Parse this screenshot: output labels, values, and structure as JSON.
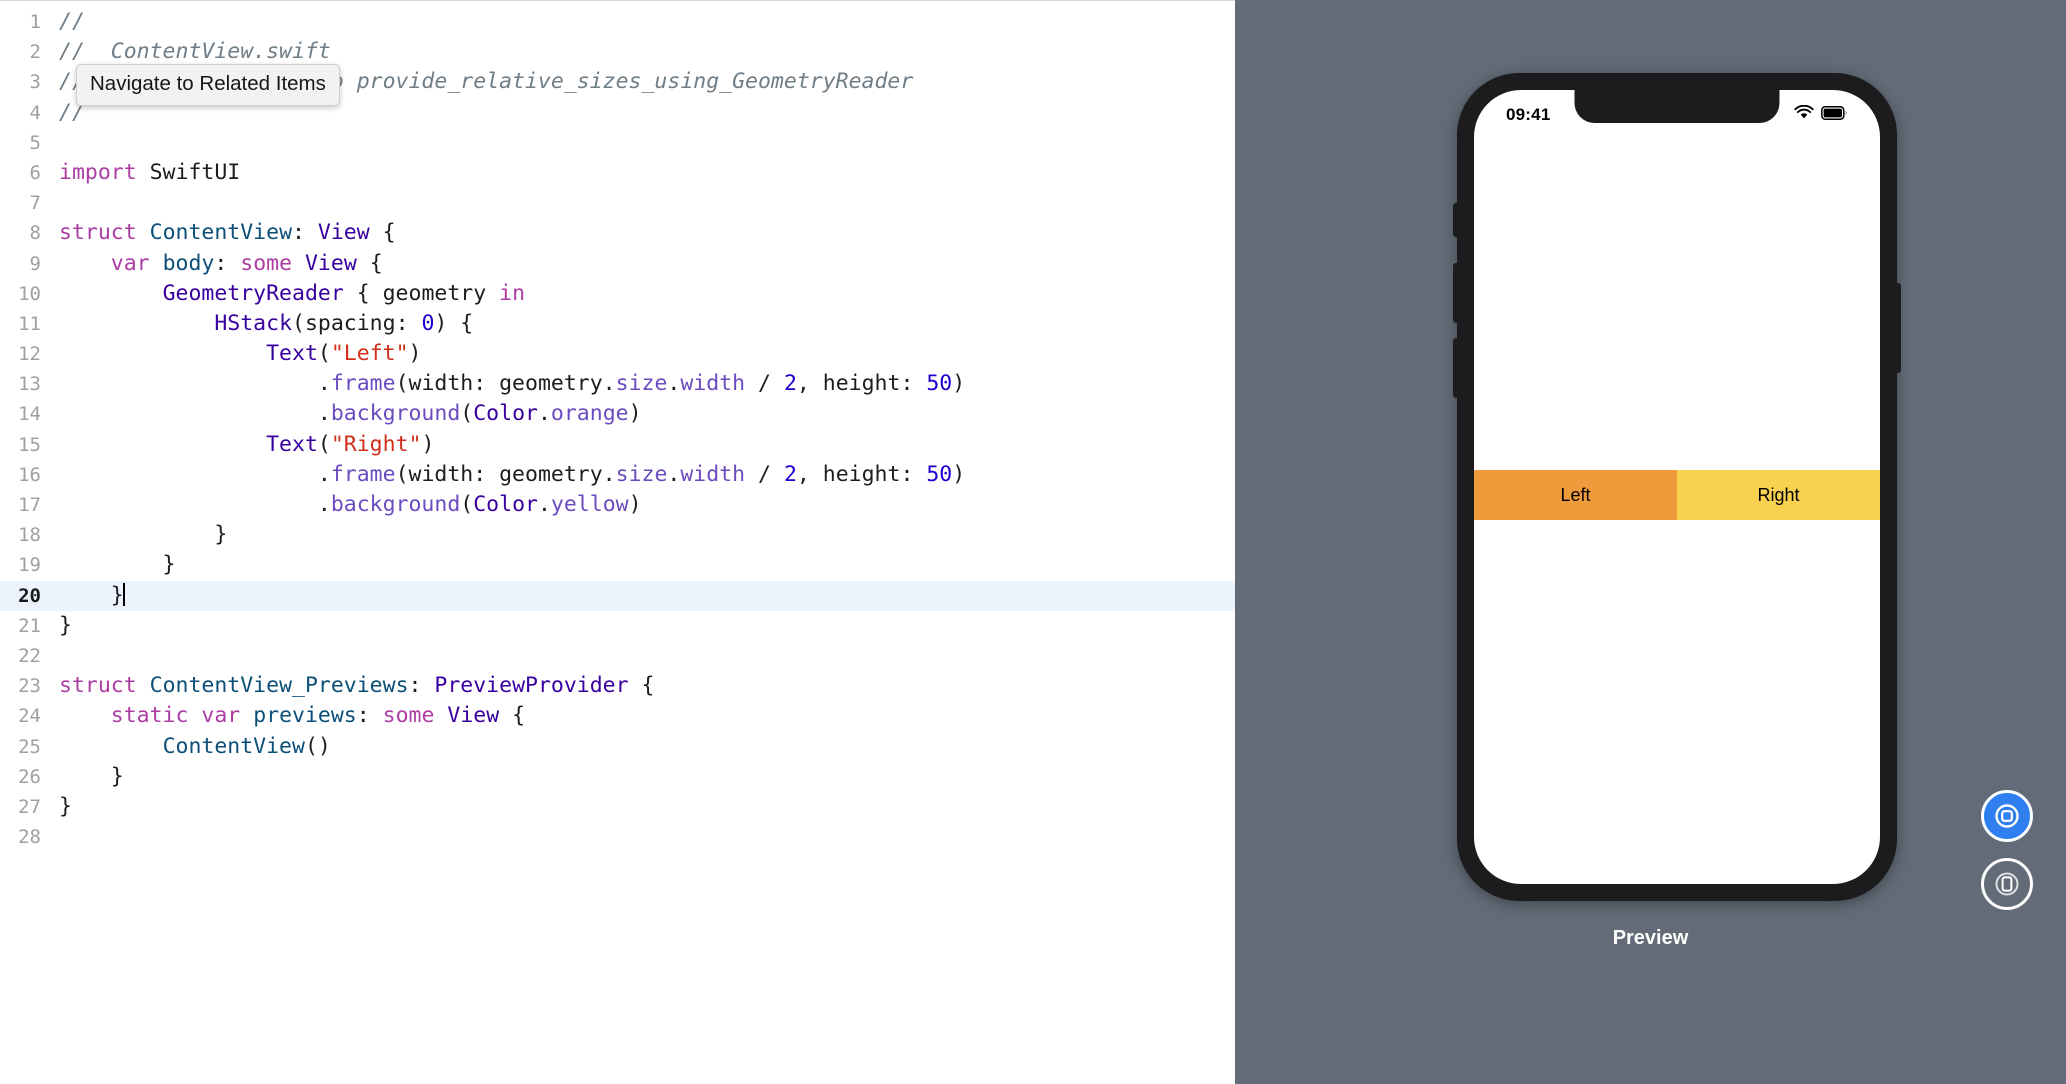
{
  "editor": {
    "tooltip": "Navigate to Related Items",
    "current_line": 20,
    "lines": [
      {
        "n": "1",
        "tokens": [
          {
            "t": "cmt",
            "s": "//"
          }
        ]
      },
      {
        "n": "2",
        "tokens": [
          {
            "t": "cmt",
            "s": "//  ContentView.swift"
          }
        ]
      },
      {
        "n": "3",
        "tokens": [
          {
            "t": "cmt",
            "s": "//  Project2-12 How to provide_relative_sizes_using_GeometryReader"
          }
        ]
      },
      {
        "n": "4",
        "tokens": [
          {
            "t": "cmt",
            "s": "//"
          }
        ]
      },
      {
        "n": "5",
        "tokens": []
      },
      {
        "n": "6",
        "tokens": [
          {
            "t": "kw",
            "s": "import"
          },
          {
            "t": "plain",
            "s": " SwiftUI"
          }
        ]
      },
      {
        "n": "7",
        "tokens": []
      },
      {
        "n": "8",
        "tokens": [
          {
            "t": "kw",
            "s": "struct"
          },
          {
            "t": "plain",
            "s": " "
          },
          {
            "t": "typ",
            "s": "ContentView"
          },
          {
            "t": "plain",
            "s": ": "
          },
          {
            "t": "typ2",
            "s": "View"
          },
          {
            "t": "plain",
            "s": " {"
          }
        ]
      },
      {
        "n": "9",
        "tokens": [
          {
            "t": "plain",
            "s": "    "
          },
          {
            "t": "kw",
            "s": "var"
          },
          {
            "t": "plain",
            "s": " "
          },
          {
            "t": "typ",
            "s": "body"
          },
          {
            "t": "plain",
            "s": ": "
          },
          {
            "t": "kw",
            "s": "some"
          },
          {
            "t": "plain",
            "s": " "
          },
          {
            "t": "typ2",
            "s": "View"
          },
          {
            "t": "plain",
            "s": " {"
          }
        ]
      },
      {
        "n": "10",
        "tokens": [
          {
            "t": "plain",
            "s": "        "
          },
          {
            "t": "typ2",
            "s": "GeometryReader"
          },
          {
            "t": "plain",
            "s": " { geometry "
          },
          {
            "t": "kw",
            "s": "in"
          }
        ]
      },
      {
        "n": "11",
        "tokens": [
          {
            "t": "plain",
            "s": "            "
          },
          {
            "t": "typ2",
            "s": "HStack"
          },
          {
            "t": "plain",
            "s": "(spacing: "
          },
          {
            "t": "num",
            "s": "0"
          },
          {
            "t": "plain",
            "s": ") {"
          }
        ]
      },
      {
        "n": "12",
        "tokens": [
          {
            "t": "plain",
            "s": "                "
          },
          {
            "t": "typ2",
            "s": "Text"
          },
          {
            "t": "plain",
            "s": "("
          },
          {
            "t": "str",
            "s": "\"Left\""
          },
          {
            "t": "plain",
            "s": ")"
          }
        ]
      },
      {
        "n": "13",
        "tokens": [
          {
            "t": "plain",
            "s": "                    ."
          },
          {
            "t": "prop",
            "s": "frame"
          },
          {
            "t": "plain",
            "s": "(width: geometry."
          },
          {
            "t": "prop",
            "s": "size"
          },
          {
            "t": "plain",
            "s": "."
          },
          {
            "t": "prop",
            "s": "width"
          },
          {
            "t": "plain",
            "s": " / "
          },
          {
            "t": "num",
            "s": "2"
          },
          {
            "t": "plain",
            "s": ", height: "
          },
          {
            "t": "num",
            "s": "50"
          },
          {
            "t": "plain",
            "s": ")"
          }
        ]
      },
      {
        "n": "14",
        "tokens": [
          {
            "t": "plain",
            "s": "                    ."
          },
          {
            "t": "prop",
            "s": "background"
          },
          {
            "t": "plain",
            "s": "("
          },
          {
            "t": "typ2",
            "s": "Color"
          },
          {
            "t": "plain",
            "s": "."
          },
          {
            "t": "prop",
            "s": "orange"
          },
          {
            "t": "plain",
            "s": ")"
          }
        ]
      },
      {
        "n": "15",
        "tokens": [
          {
            "t": "plain",
            "s": "                "
          },
          {
            "t": "typ2",
            "s": "Text"
          },
          {
            "t": "plain",
            "s": "("
          },
          {
            "t": "str",
            "s": "\"Right\""
          },
          {
            "t": "plain",
            "s": ")"
          }
        ]
      },
      {
        "n": "16",
        "tokens": [
          {
            "t": "plain",
            "s": "                    ."
          },
          {
            "t": "prop",
            "s": "frame"
          },
          {
            "t": "plain",
            "s": "(width: geometry."
          },
          {
            "t": "prop",
            "s": "size"
          },
          {
            "t": "plain",
            "s": "."
          },
          {
            "t": "prop",
            "s": "width"
          },
          {
            "t": "plain",
            "s": " / "
          },
          {
            "t": "num",
            "s": "2"
          },
          {
            "t": "plain",
            "s": ", height: "
          },
          {
            "t": "num",
            "s": "50"
          },
          {
            "t": "plain",
            "s": ")"
          }
        ]
      },
      {
        "n": "17",
        "tokens": [
          {
            "t": "plain",
            "s": "                    ."
          },
          {
            "t": "prop",
            "s": "background"
          },
          {
            "t": "plain",
            "s": "("
          },
          {
            "t": "typ2",
            "s": "Color"
          },
          {
            "t": "plain",
            "s": "."
          },
          {
            "t": "prop",
            "s": "yellow"
          },
          {
            "t": "plain",
            "s": ")"
          }
        ]
      },
      {
        "n": "18",
        "tokens": [
          {
            "t": "plain",
            "s": "            }"
          }
        ]
      },
      {
        "n": "19",
        "tokens": [
          {
            "t": "plain",
            "s": "        }"
          }
        ]
      },
      {
        "n": "20",
        "tokens": [
          {
            "t": "plain",
            "s": "    }"
          }
        ],
        "caret": true
      },
      {
        "n": "21",
        "tokens": [
          {
            "t": "plain",
            "s": "}"
          }
        ]
      },
      {
        "n": "22",
        "tokens": []
      },
      {
        "n": "23",
        "tokens": [
          {
            "t": "kw",
            "s": "struct"
          },
          {
            "t": "plain",
            "s": " "
          },
          {
            "t": "typ",
            "s": "ContentView_Previews"
          },
          {
            "t": "plain",
            "s": ": "
          },
          {
            "t": "typ2",
            "s": "PreviewProvider"
          },
          {
            "t": "plain",
            "s": " {"
          }
        ]
      },
      {
        "n": "24",
        "tokens": [
          {
            "t": "plain",
            "s": "    "
          },
          {
            "t": "kw",
            "s": "static"
          },
          {
            "t": "plain",
            "s": " "
          },
          {
            "t": "kw",
            "s": "var"
          },
          {
            "t": "plain",
            "s": " "
          },
          {
            "t": "typ",
            "s": "previews"
          },
          {
            "t": "plain",
            "s": ": "
          },
          {
            "t": "kw",
            "s": "some"
          },
          {
            "t": "plain",
            "s": " "
          },
          {
            "t": "typ2",
            "s": "View"
          },
          {
            "t": "plain",
            "s": " {"
          }
        ]
      },
      {
        "n": "25",
        "tokens": [
          {
            "t": "plain",
            "s": "        "
          },
          {
            "t": "typ",
            "s": "ContentView"
          },
          {
            "t": "plain",
            "s": "()"
          }
        ]
      },
      {
        "n": "26",
        "tokens": [
          {
            "t": "plain",
            "s": "    }"
          }
        ]
      },
      {
        "n": "27",
        "tokens": [
          {
            "t": "plain",
            "s": "}"
          }
        ]
      },
      {
        "n": "28",
        "tokens": []
      }
    ]
  },
  "preview": {
    "label": "Preview",
    "background_color": "#626b77",
    "device": {
      "status_bar": {
        "time": "09:41",
        "wifi_icon": "wifi-icon",
        "battery_icon": "battery-icon"
      },
      "content": {
        "cells": [
          {
            "label": "Left",
            "color": "#ef9a3b",
            "width_fraction": 0.5,
            "height": 50
          },
          {
            "label": "Right",
            "color": "#f8d14f",
            "width_fraction": 0.5,
            "height": 50
          }
        ]
      }
    },
    "controls": [
      {
        "name": "live-preview-button",
        "icon": "live-preview-icon",
        "active": true,
        "accent": "#2f7ff0"
      },
      {
        "name": "preview-on-device-button",
        "icon": "device-preview-icon",
        "active": false,
        "accent": "#ffffff"
      }
    ]
  }
}
